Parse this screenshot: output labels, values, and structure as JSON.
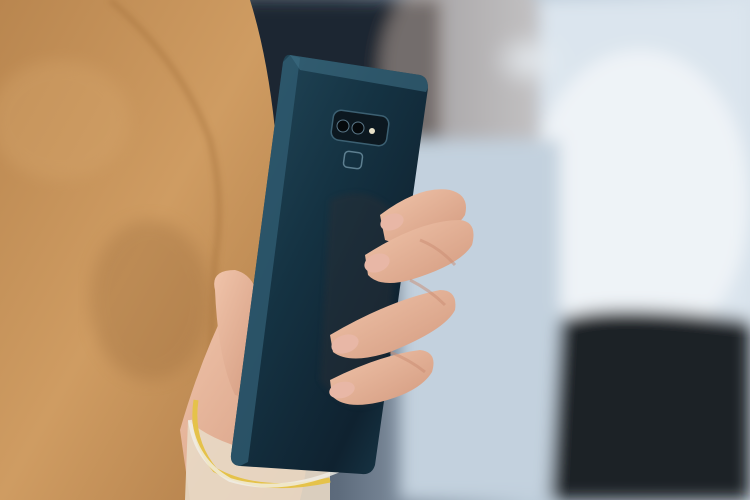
{
  "scene": {
    "description_visible_text": "",
    "colors": {
      "sweater": "#c8955b",
      "sweater_shadow": "#9c6d3c",
      "background_blue": "#aebfd0",
      "background_dark": "#1e2530",
      "phone_body": "#163040",
      "phone_highlight": "#2f5b70",
      "skin": "#e7b59a",
      "skin_shadow": "#c98b72",
      "bracelet": "#e5c24a"
    }
  }
}
